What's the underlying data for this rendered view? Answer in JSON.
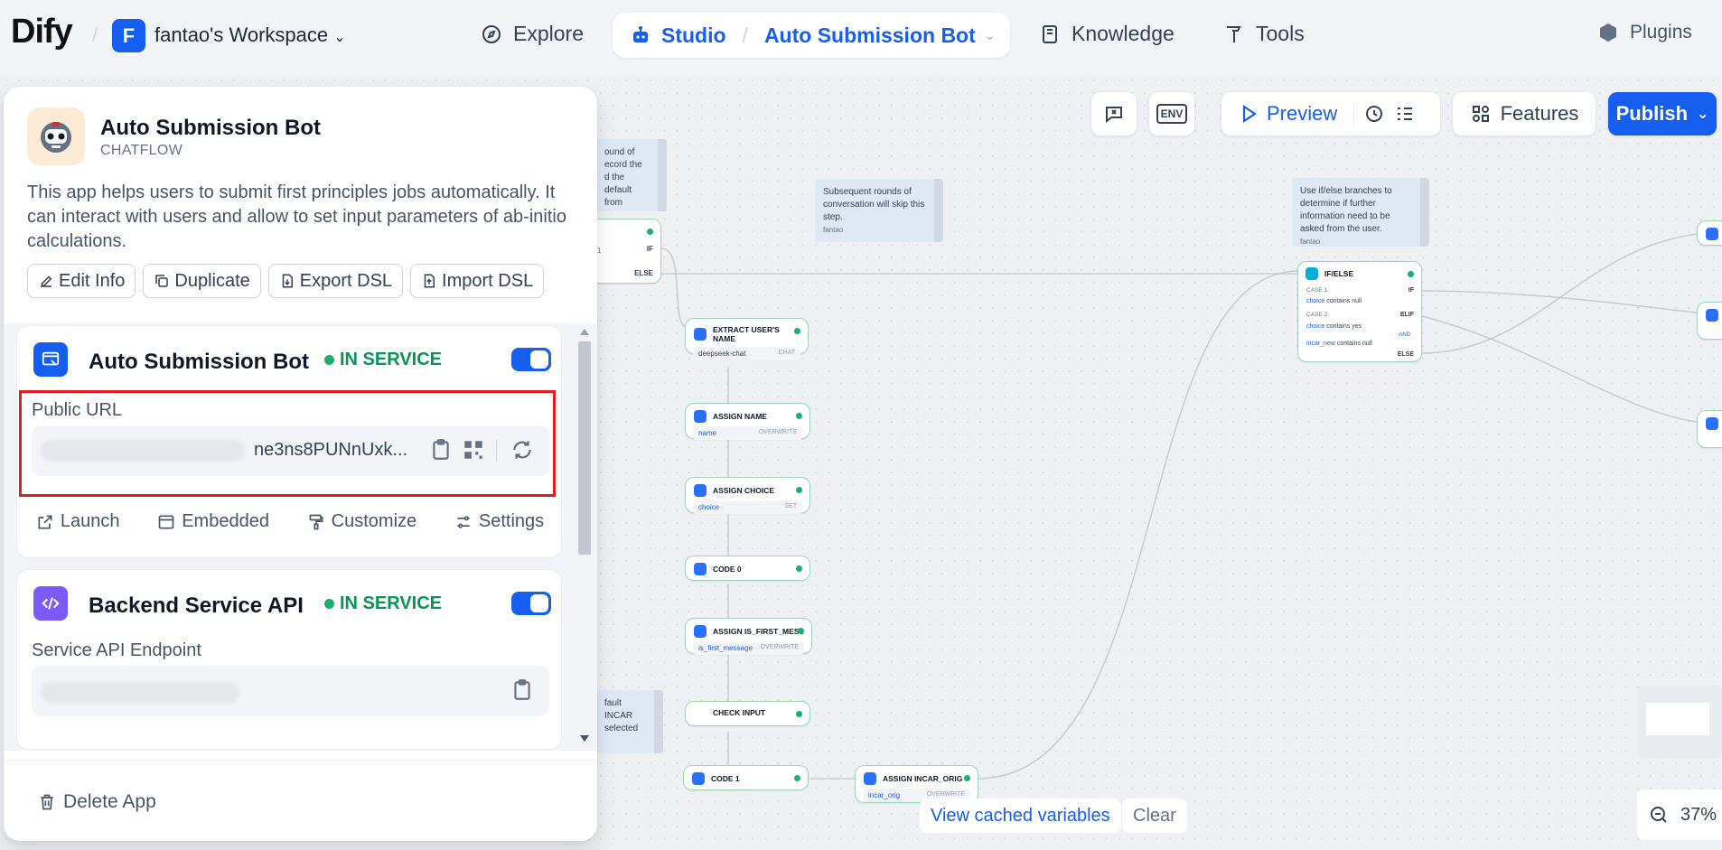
{
  "nav": {
    "logo": "Dify",
    "workspace_initial": "F",
    "workspace_name": "fantao's Workspace",
    "explore": "Explore",
    "studio": "Studio",
    "app_name": "Auto Submission Bot",
    "knowledge": "Knowledge",
    "tools": "Tools",
    "plugins": "Plugins"
  },
  "toolbar": {
    "preview": "Preview",
    "features": "Features",
    "publish": "Publish",
    "env_label": "ENV"
  },
  "panel": {
    "app_title": "Auto Submission Bot",
    "app_mode": "CHATFLOW",
    "description": "This app helps users to submit first principles jobs automatically. It can interact with users and allow to set input parameters of ab-initio calculations.",
    "actions": [
      "Edit Info",
      "Duplicate",
      "Export DSL",
      "Import DSL"
    ],
    "webapp": {
      "title": "Auto Submission Bot",
      "status": "IN SERVICE",
      "enabled": true,
      "url_label": "Public URL",
      "url_visible": "ne3ns8PUNnUxk...",
      "links": [
        "Launch",
        "Embedded",
        "Customize",
        "Settings"
      ]
    },
    "api": {
      "title": "Backend Service API",
      "status": "IN SERVICE",
      "enabled": true,
      "endpoint_label": "Service API Endpoint"
    },
    "delete": "Delete App"
  },
  "canvas": {
    "notes": [
      {
        "text": "ound of ecord the d the default from"
      },
      {
        "text": "Subsequent rounds of conversation will skip this step.",
        "author": "fantao"
      },
      {
        "text": "Use if/else branches to determine if further information need to be asked from the user.",
        "author": "fantao"
      },
      {
        "text": "fault INCAR selected"
      }
    ],
    "nodes": {
      "start_if": "IF",
      "start_else": "ELSE",
      "start_case": "1",
      "extract": {
        "title": "EXTRACT USER'S NAME",
        "model": "deepseek-chat",
        "tag": "CHAT"
      },
      "assign_name": {
        "title": "ASSIGN NAME",
        "var": "name",
        "tag": "OVERWRITE"
      },
      "assign_choice": {
        "title": "ASSIGN CHOICE",
        "var": "choice",
        "tag": "SET"
      },
      "code0": {
        "title": "CODE 0"
      },
      "assign_first": {
        "title": "ASSIGN IS_FIRST_MESSAG",
        "var": "is_first_message",
        "tag": "OVERWRITE"
      },
      "check_input": {
        "title": "CHECK INPUT"
      },
      "code1": {
        "title": "CODE 1"
      },
      "assign_incar": {
        "title": "ASSIGN INCAR_ORIG",
        "var": "incar_orig",
        "tag": "OVERWRITE"
      },
      "ifelse": {
        "title": "IF/ELSE",
        "case1": "CASE 1",
        "if": "IF",
        "c1_var": "choice",
        "c1_op": "contains null",
        "case2": "CASE 2",
        "elif": "ELIF",
        "c2_var1": "choice",
        "c2_op1": "contains yes",
        "and": "AND",
        "c2_var2": "incar_new",
        "c2_op2": "contains null",
        "else": "ELSE"
      }
    },
    "view_cached": "View cached variables",
    "clear": "Clear",
    "zoom": "37%"
  }
}
